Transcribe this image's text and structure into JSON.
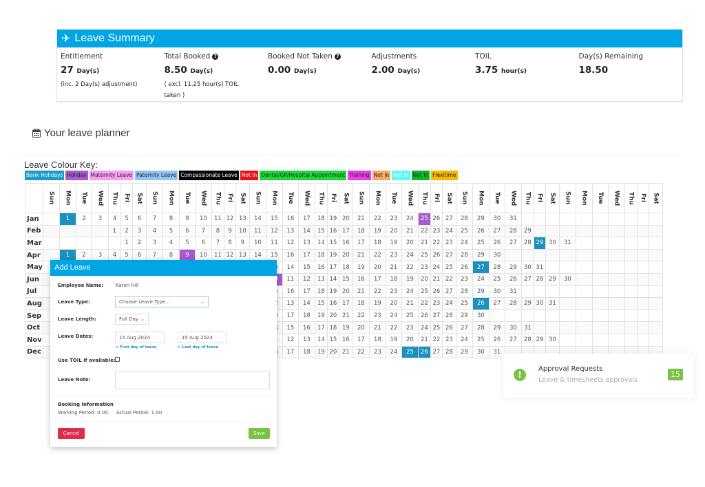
{
  "summary": {
    "title": "Leave Summary",
    "icon": "plane-icon",
    "items": [
      {
        "label": "Entitlement",
        "value": "27",
        "unit": "Day(s)",
        "note": "(inc. 2 Day(s) adjustment)",
        "help": false
      },
      {
        "label": "Total Booked",
        "value": "8.50",
        "unit": "Day(s)",
        "note": "( excl. 11.25 hour(s) TOIL taken )",
        "help": true
      },
      {
        "label": "Booked Not Taken",
        "value": "0.00",
        "unit": "Day(s)",
        "note": "",
        "help": true
      },
      {
        "label": "Adjustments",
        "value": "2.00",
        "unit": "Day(s)",
        "note": "",
        "help": false
      },
      {
        "label": "TOIL",
        "value": "3.75",
        "unit": "hour(s)",
        "note": "",
        "help": false
      },
      {
        "label": "Day(s) Remaining",
        "value": "18.50",
        "unit": "",
        "note": "",
        "help": false
      }
    ]
  },
  "planner": {
    "title": "Your leave planner",
    "icon": "calendar-icon"
  },
  "key": {
    "title": "Leave Colour Key:",
    "items": [
      {
        "label": "Bank Holidays",
        "bg": "#1a9bc7",
        "fg": "#ffffff"
      },
      {
        "label": "Holiday",
        "bg": "#a65bd0",
        "fg": "#222222"
      },
      {
        "label": "Maternity Leave",
        "bg": "#f7a0f2",
        "fg": "#222222"
      },
      {
        "label": "Paternity Leave",
        "bg": "#92c5f5",
        "fg": "#222222"
      },
      {
        "label": "Compassionate Leave",
        "bg": "#000000",
        "fg": "#ffffff"
      },
      {
        "label": "Not In",
        "bg": "#e8101a",
        "fg": "#ffffff"
      },
      {
        "label": "Dental/GP/Hospital Appointment",
        "bg": "#1fd83a",
        "fg": "#222222"
      },
      {
        "label": "Training",
        "bg": "#ea3ee8",
        "fg": "#222222"
      },
      {
        "label": "Not In",
        "bg": "#f5a96a",
        "fg": "#222222"
      },
      {
        "label": "Not In",
        "bg": "#5ff7f7",
        "fg": "#ffffff"
      },
      {
        "label": "Not In",
        "bg": "#0bb82c",
        "fg": "#222222"
      },
      {
        "label": "Flexitime",
        "bg": "#f8b800",
        "fg": "#222222"
      }
    ]
  },
  "calendar": {
    "weekdays": [
      "Sun",
      "Mon",
      "Tue",
      "Wed",
      "Thu",
      "Fri",
      "Sat"
    ],
    "weeks_shown": 6,
    "months": [
      {
        "name": "Jan",
        "first_weekday": 1,
        "days": 31
      },
      {
        "name": "Feb",
        "first_weekday": 4,
        "days": 29
      },
      {
        "name": "Mar",
        "first_weekday": 5,
        "days": 31
      },
      {
        "name": "Apr",
        "first_weekday": 1,
        "days": 30
      },
      {
        "name": "May",
        "first_weekday": 3,
        "days": 31
      },
      {
        "name": "Jun",
        "first_weekday": 6,
        "days": 30
      },
      {
        "name": "Jul",
        "first_weekday": 1,
        "days": 31
      },
      {
        "name": "Aug",
        "first_weekday": 4,
        "days": 31
      },
      {
        "name": "Sep",
        "first_weekday": 0,
        "days": 30
      },
      {
        "name": "Oct",
        "first_weekday": 2,
        "days": 31
      },
      {
        "name": "Nov",
        "first_weekday": 5,
        "days": 30
      },
      {
        "name": "Dec",
        "first_weekday": 0,
        "days": 31
      }
    ],
    "highlights": [
      {
        "month": "Jan",
        "day": 1,
        "type": "Bank Holidays",
        "color": "#1a92bd"
      },
      {
        "month": "Jan",
        "day": 25,
        "type": "Holiday",
        "color": "#a65bd0"
      },
      {
        "month": "Mar",
        "day": 29,
        "type": "Bank Holidays",
        "color": "#1a92bd"
      },
      {
        "month": "Apr",
        "day": 1,
        "type": "Bank Holidays",
        "color": "#1a92bd"
      },
      {
        "month": "Apr",
        "day": 9,
        "type": "Holiday",
        "color": "#a65bd0"
      },
      {
        "month": "May",
        "day": 27,
        "type": "Bank Holidays",
        "color": "#1a92bd"
      },
      {
        "month": "Jun",
        "day": 10,
        "type": "Holiday",
        "color": "#a65bd0"
      },
      {
        "month": "Aug",
        "day": 26,
        "type": "Bank Holidays",
        "color": "#1a92bd"
      },
      {
        "month": "Dec",
        "day": 25,
        "type": "Bank Holidays",
        "color": "#1a92bd"
      },
      {
        "month": "Dec",
        "day": 26,
        "type": "Bank Holidays",
        "color": "#1a92bd"
      }
    ]
  },
  "modal": {
    "title": "Add Leave",
    "employee_label": "Employee Name:",
    "employee_value": "Karen Hill",
    "type_label": "Leave Type:",
    "type_value": "Choose Leave Type...",
    "length_label": "Leave Length:",
    "length_value": "Full Day",
    "dates_label": "Leave Dates:",
    "start_date": "15 Aug 2024",
    "end_date": "15 Aug 2024",
    "start_hint": "First day of leave",
    "end_hint": "Last day of leave",
    "toil_label": "Use TOIL if available:",
    "toil_checked": false,
    "note_label": "Leave Note:",
    "note_value": "",
    "booking_title": "Booking Information",
    "working_period": "Working Period:  0.00",
    "actual_period": "Actual Period: 1.00",
    "cancel": "Cancel",
    "save": "Save"
  },
  "approval": {
    "title": "Approval Requests",
    "subtitle": "Leave & timesheets approvals",
    "count": "15",
    "icon": "alert-icon",
    "accent": "#7cc242"
  }
}
